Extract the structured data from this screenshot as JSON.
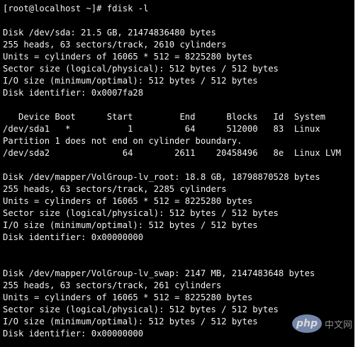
{
  "terminal": {
    "lines": [
      "[root@localhost ~]# fdisk -l",
      "",
      "Disk /dev/sda: 21.5 GB, 21474836480 bytes",
      "255 heads, 63 sectors/track, 2610 cylinders",
      "Units = cylinders of 16065 * 512 = 8225280 bytes",
      "Sector size (logical/physical): 512 bytes / 512 bytes",
      "I/O size (minimum/optimal): 512 bytes / 512 bytes",
      "Disk identifier: 0x0007fa28",
      "",
      "   Device Boot      Start         End      Blocks   Id  System",
      "/dev/sda1   *           1          64      512000   83  Linux",
      "Partition 1 does not end on cylinder boundary.",
      "/dev/sda2              64        2611    20458496   8e  Linux LVM",
      "",
      "Disk /dev/mapper/VolGroup-lv_root: 18.8 GB, 18798870528 bytes",
      "255 heads, 63 sectors/track, 2285 cylinders",
      "Units = cylinders of 16065 * 512 = 8225280 bytes",
      "Sector size (logical/physical): 512 bytes / 512 bytes",
      "I/O size (minimum/optimal): 512 bytes / 512 bytes",
      "Disk identifier: 0x00000000",
      "",
      "",
      "Disk /dev/mapper/VolGroup-lv_swap: 2147 MB, 2147483648 bytes",
      "255 heads, 63 sectors/track, 261 cylinders",
      "Units = cylinders of 16065 * 512 = 8225280 bytes",
      "Sector size (logical/physical): 512 bytes / 512 bytes",
      "I/O size (minimum/optimal): 512 bytes / 512 bytes",
      "Disk identifier: 0x00000000"
    ]
  },
  "watermark": {
    "logo_text": "php",
    "site_text": "中文网"
  },
  "colors": {
    "background": "#000000",
    "foreground": "#f2f2f2"
  }
}
